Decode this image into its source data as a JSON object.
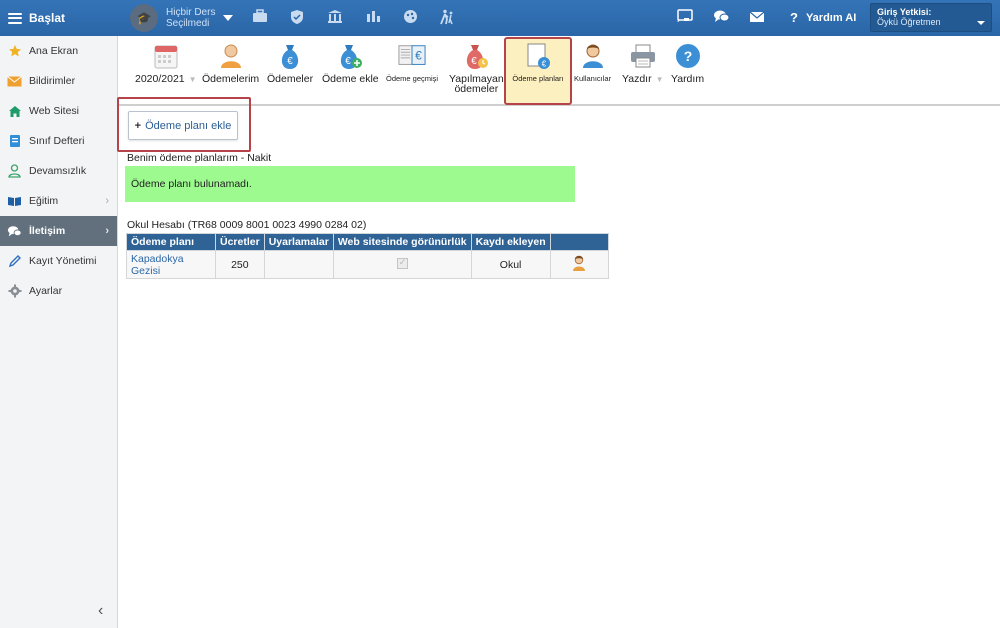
{
  "topbar": {
    "brand_label": "Başlat",
    "course_line1": "Hiçbir Ders",
    "course_line2": "Seçilmedi",
    "help_ai_label": "Yardım AI",
    "auth_title": "Giriş Yetkisi:",
    "auth_value": "Öykü Öğretmen",
    "icons": [
      "briefcase-icon",
      "shield-icon",
      "institution-icon",
      "bar-chart-icon",
      "palette-icon",
      "walking-icon"
    ],
    "right_icons": [
      "cast-icon",
      "chat-icon",
      "mail-icon"
    ]
  },
  "sidebar": {
    "items": [
      {
        "label": "Ana Ekran",
        "icon": "star-icon",
        "active": false
      },
      {
        "label": "Bildirimler",
        "icon": "envelope-icon",
        "active": false
      },
      {
        "label": "Web Sitesi",
        "icon": "home-icon",
        "active": false
      },
      {
        "label": "Sınıf Defteri",
        "icon": "notebook-icon",
        "active": false
      },
      {
        "label": "Devamsızlık",
        "icon": "person-icon",
        "active": false
      },
      {
        "label": "Eğitim",
        "icon": "book-icon",
        "active": false
      },
      {
        "label": "İletişim",
        "icon": "comments-icon",
        "active": true
      },
      {
        "label": "Kayıt Yönetimi",
        "icon": "pen-icon",
        "active": false
      },
      {
        "label": "Ayarlar",
        "icon": "cog-icon",
        "active": false
      }
    ]
  },
  "toolbar": {
    "year": "2020/2021",
    "items": [
      {
        "label": "Ödemelerim"
      },
      {
        "label": "Ödemeler"
      },
      {
        "label": "Ödeme ekle"
      },
      {
        "label": "Ödeme geçmişi"
      },
      {
        "label1": "Yapılmayan",
        "label2": "ödemeler"
      },
      {
        "label": "Ödeme planları"
      },
      {
        "label": "Kullanıcılar"
      },
      {
        "label": "Yazdır"
      },
      {
        "label": "Yardım"
      }
    ]
  },
  "main": {
    "add_button_label": "Ödeme planı ekle",
    "my_plans_title": "Benim ödeme planlarım - Nakit",
    "no_plan_message": "Ödeme planı bulunamadı.",
    "account_title": "Okul Hesabı (TR68 0009 8001 0023 4990 0284 02)",
    "table": {
      "headers": [
        "Ödeme planı",
        "Ücretler",
        "Uyarlamalar",
        "Web sitesinde görünürlük",
        "Kaydı ekleyen",
        ""
      ],
      "rows": [
        {
          "plan": "Kapadokya Gezisi",
          "fee": "250",
          "adjustments": "",
          "web_visible": true,
          "added_by": "Okul"
        }
      ]
    }
  }
}
